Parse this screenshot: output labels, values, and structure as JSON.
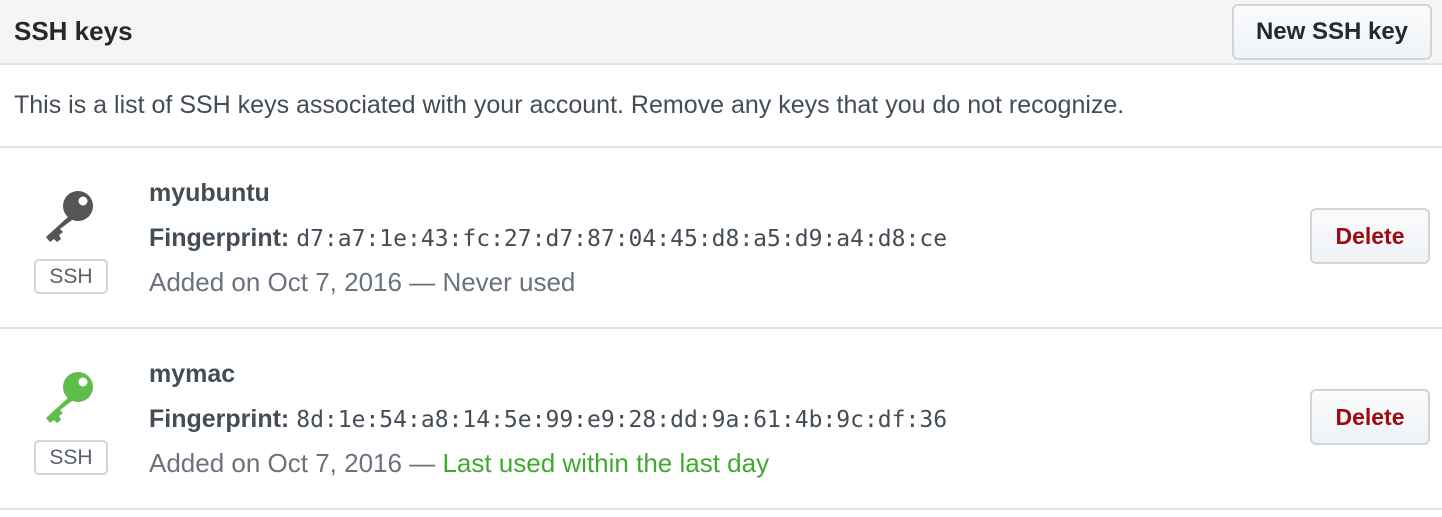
{
  "header": {
    "title": "SSH keys",
    "new_key_label": "New SSH key"
  },
  "intro_text": "This is a list of SSH keys associated with your account. Remove any keys that you do not recognize.",
  "keys": [
    {
      "title": "myubuntu",
      "fingerprint_label": "Fingerprint:",
      "fingerprint": "d7:a7:1e:43:fc:27:d7:87:04:45:d8:a5:d9:a4:d8:ce",
      "added": "Added on Oct 7, 2016 —",
      "usage": "Never used",
      "badge": "SSH",
      "icon": "key-icon",
      "icon_color": "#555555",
      "delete_label": "Delete"
    },
    {
      "title": "mymac",
      "fingerprint_label": "Fingerprint:",
      "fingerprint": "8d:1e:54:a8:14:5e:99:e9:28:dd:9a:61:4b:9c:df:36",
      "added": "Added on Oct 7, 2016 —",
      "usage": "Last used within the last day",
      "badge": "SSH",
      "icon": "key-icon",
      "icon_color": "#5fbd4a",
      "delete_label": "Delete"
    }
  ]
}
